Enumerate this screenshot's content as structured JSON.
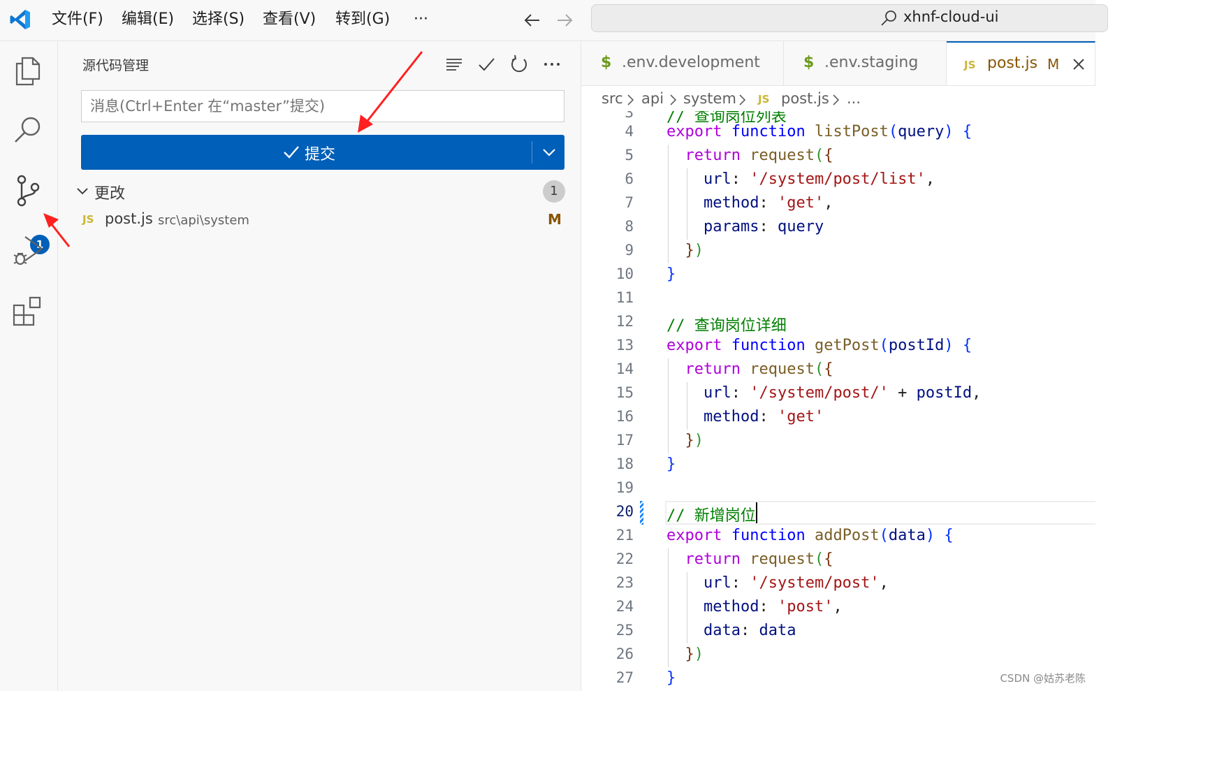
{
  "menu": [
    "文件(F)",
    "编辑(E)",
    "选择(S)",
    "查看(V)",
    "转到(G)",
    "···"
  ],
  "search": {
    "text": "xhnf-cloud-ui"
  },
  "activity": {
    "scm_badge": "1"
  },
  "sidebar": {
    "title": "源代码管理",
    "commit_placeholder": "消息(Ctrl+Enter 在“master”提交)",
    "commit_label": "提交",
    "changes_label": "更改",
    "changes_count": "1",
    "file": {
      "icon": "JS",
      "name": "post.js",
      "path": "src\\api\\system",
      "status": "M"
    }
  },
  "tabs": [
    {
      "icon": "$",
      "label": ".env.development"
    },
    {
      "icon": "$",
      "label": ".env.staging"
    },
    {
      "icon": "JS",
      "label": "post.js",
      "status": "M"
    }
  ],
  "breadcrumb": [
    "src",
    "api",
    "system",
    "JS",
    "post.js",
    "..."
  ],
  "code": {
    "partial_line_number": "3",
    "partial_line": "// 查询岗位列表",
    "lines": [
      {
        "n": "4",
        "text": "export function listPost(query) {"
      },
      {
        "n": "5",
        "text": "  return request({"
      },
      {
        "n": "6",
        "text": "    url: '/system/post/list',"
      },
      {
        "n": "7",
        "text": "    method: 'get',"
      },
      {
        "n": "8",
        "text": "    params: query"
      },
      {
        "n": "9",
        "text": "  })"
      },
      {
        "n": "10",
        "text": "}"
      },
      {
        "n": "11",
        "text": ""
      },
      {
        "n": "12",
        "text": "// 查询岗位详细"
      },
      {
        "n": "13",
        "text": "export function getPost(postId) {"
      },
      {
        "n": "14",
        "text": "  return request({"
      },
      {
        "n": "15",
        "text": "    url: '/system/post/' + postId,"
      },
      {
        "n": "16",
        "text": "    method: 'get'"
      },
      {
        "n": "17",
        "text": "  })"
      },
      {
        "n": "18",
        "text": "}"
      },
      {
        "n": "19",
        "text": ""
      },
      {
        "n": "20",
        "text": "// 新增岗位"
      },
      {
        "n": "21",
        "text": "export function addPost(data) {"
      },
      {
        "n": "22",
        "text": "  return request({"
      },
      {
        "n": "23",
        "text": "    url: '/system/post',"
      },
      {
        "n": "24",
        "text": "    method: 'post',"
      },
      {
        "n": "25",
        "text": "    data: data"
      },
      {
        "n": "26",
        "text": "  })"
      },
      {
        "n": "27",
        "text": "}"
      }
    ],
    "active_line": "20"
  },
  "watermark": "CSDN @姑苏老陈",
  "colors": {
    "accent": "#005fb8",
    "modified": "#895503",
    "js_icon": "#c9b635",
    "env_icon": "#6c9a1e",
    "annotation_arrow": "#ff2020"
  },
  "icons": {
    "activity": [
      "explorer-icon",
      "search-icon",
      "source-control-icon",
      "run-debug-icon",
      "extensions-icon"
    ],
    "sidebar_actions": [
      "view-as-tree-icon",
      "commit-check-icon",
      "refresh-icon",
      "more-actions-icon"
    ]
  }
}
